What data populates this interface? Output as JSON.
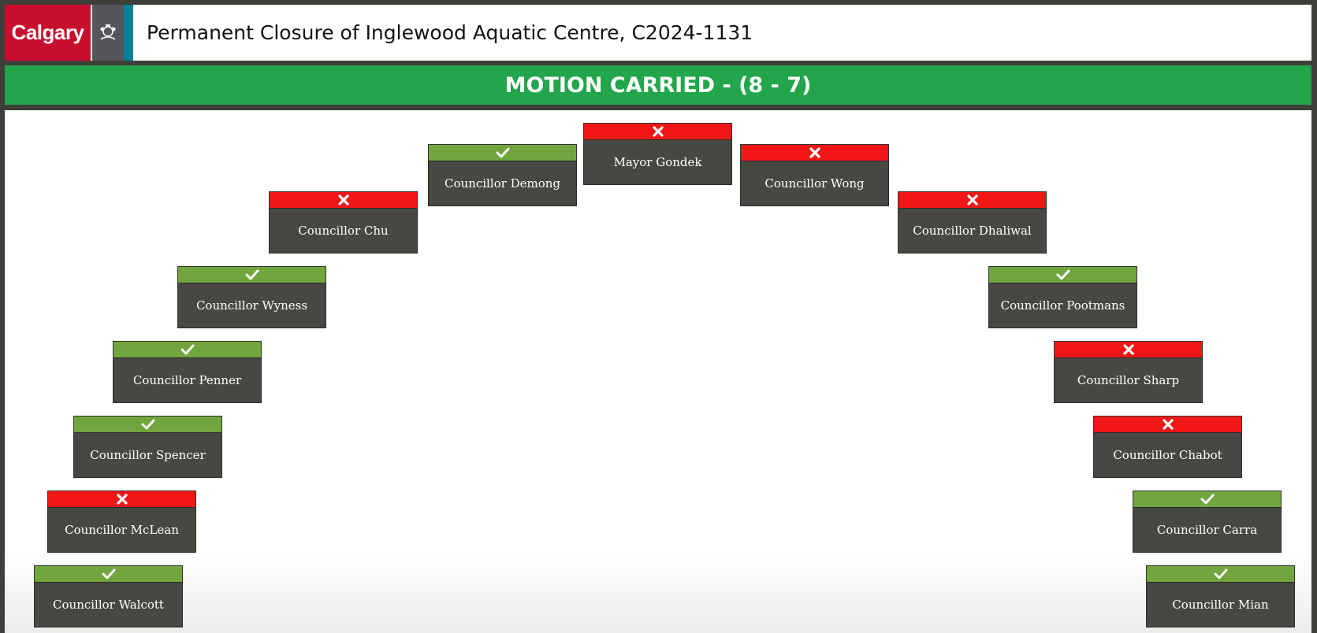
{
  "header": {
    "logo_text": "Calgary",
    "title": "Permanent Closure of Inglewood Aquatic Centre, C2024-1131"
  },
  "banner": {
    "result": "MOTION CARRIED - (8 - 7)"
  },
  "colors": {
    "yes": "#71a53e",
    "no": "#f11717",
    "carried": "#22a54b",
    "brand_red": "#c8102e"
  },
  "members": [
    {
      "name": "Mayor Gondek",
      "vote": "no"
    },
    {
      "name": "Councillor Demong",
      "vote": "yes"
    },
    {
      "name": "Councillor Wong",
      "vote": "no"
    },
    {
      "name": "Councillor Chu",
      "vote": "no"
    },
    {
      "name": "Councillor Dhaliwal",
      "vote": "no"
    },
    {
      "name": "Councillor Wyness",
      "vote": "yes"
    },
    {
      "name": "Councillor Pootmans",
      "vote": "yes"
    },
    {
      "name": "Councillor Penner",
      "vote": "yes"
    },
    {
      "name": "Councillor Sharp",
      "vote": "no"
    },
    {
      "name": "Councillor Spencer",
      "vote": "yes"
    },
    {
      "name": "Councillor Chabot",
      "vote": "no"
    },
    {
      "name": "Councillor McLean",
      "vote": "no"
    },
    {
      "name": "Councillor Carra",
      "vote": "yes"
    },
    {
      "name": "Councillor Walcott",
      "vote": "yes"
    },
    {
      "name": "Councillor Mian",
      "vote": "yes"
    }
  ]
}
